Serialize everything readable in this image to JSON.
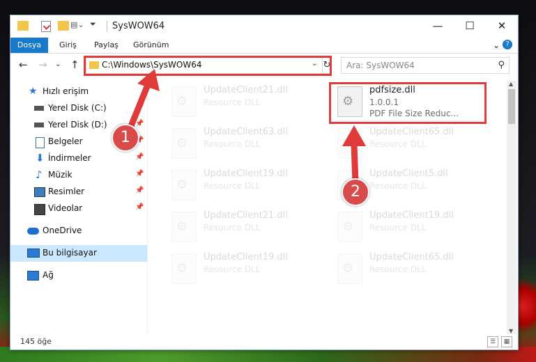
{
  "window": {
    "title": "SysWOW64",
    "minimize": "—",
    "maximize": "☐",
    "close": "✕"
  },
  "ribbon": {
    "tabs": [
      "Dosya",
      "Giriş",
      "Paylaş",
      "Görünüm"
    ],
    "expand": "⌄",
    "help": "?"
  },
  "navbar": {
    "back": "←",
    "forward": "→",
    "recent": "⌄",
    "up": "↑",
    "address": "C:\\Windows\\SysWOW64",
    "dropdown": "⌄",
    "refresh": "↻",
    "search_placeholder": "Ara: SysWOW64",
    "search_glyph": "⚲"
  },
  "sidebar": {
    "items": [
      {
        "label": "Hızlı erişim",
        "icon": "star-icon",
        "color": "#2a7ad5"
      },
      {
        "label": "Yerel Disk (C:)",
        "icon": "drive-icon",
        "color": "#555555"
      },
      {
        "label": "Yerel Disk (D:)",
        "icon": "drive-icon",
        "color": "#555555"
      },
      {
        "label": "Belgeler",
        "icon": "document-icon",
        "color": "#3a6ea5"
      },
      {
        "label": "İndirmeler",
        "icon": "download-icon",
        "color": "#2a7ad5"
      },
      {
        "label": "Müzik",
        "icon": "music-icon",
        "color": "#2a7ad5"
      },
      {
        "label": "Resimler",
        "icon": "pictures-icon",
        "color": "#3a7fbf"
      },
      {
        "label": "Videolar",
        "icon": "video-icon",
        "color": "#444444"
      },
      {
        "label": "OneDrive",
        "icon": "cloud-icon",
        "color": "#1e6fd1"
      },
      {
        "label": "Bu bilgisayar",
        "icon": "computer-icon",
        "color": "#2a7ad5"
      },
      {
        "label": "Ağ",
        "icon": "network-icon",
        "color": "#2a7ad5"
      }
    ],
    "pin_glyph": "📌"
  },
  "files": {
    "highlighted": {
      "name": "pdfsize.dll",
      "version": "1.0.0.1",
      "description": "PDF File Size Reduc..."
    },
    "ghosts": [
      {
        "name": "UpdateClient21.dll",
        "type": "Resource DLL"
      },
      {
        "name": "UpdateClient63.dll",
        "type": "Resource DLL"
      },
      {
        "name": "UpdateClient65.dll",
        "type": "Resource DLL"
      },
      {
        "name": "UpdateClient19.dll",
        "type": "Resource DLL"
      },
      {
        "name": "UpdateClient5.dll",
        "type": "Resource DLL"
      },
      {
        "name": "UpdateClient21.dll",
        "type": "Resource DLL"
      },
      {
        "name": "UpdateClient19.dll",
        "type": "Resource DLL"
      },
      {
        "name": "UpdateClient19.dll",
        "type": "Resource DLL"
      },
      {
        "name": "UpdateClient65.dll",
        "type": "Resource DLL"
      }
    ]
  },
  "status": {
    "count": "145 öğe",
    "details_view": "☰",
    "tiles_view": "▦"
  },
  "annotations": {
    "step1": "1",
    "step2": "2",
    "color": "#e03a3a"
  },
  "scrollbar": {
    "up": "▲",
    "down": "▼"
  }
}
